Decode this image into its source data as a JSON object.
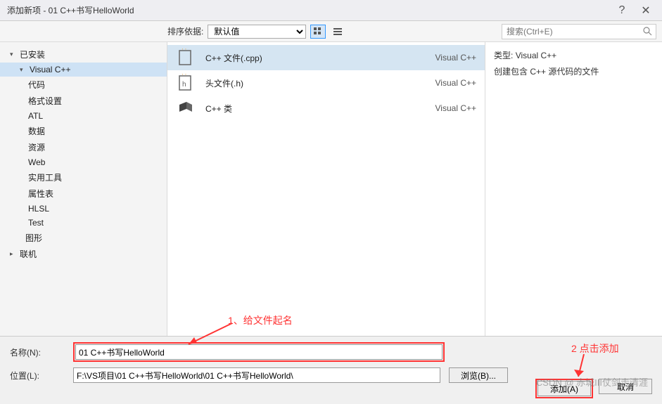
{
  "window": {
    "title": "添加新项 - 01 C++书写HelloWorld",
    "help": "?",
    "close": "✕"
  },
  "toolbar": {
    "sort_label": "排序依据:",
    "sort_value": "默认值",
    "search_placeholder": "搜索(Ctrl+E)"
  },
  "sidebar": {
    "installed": "已安装",
    "vc": "Visual C++",
    "items": [
      "代码",
      "格式设置",
      "ATL",
      "数据",
      "资源",
      "Web",
      "实用工具",
      "属性表",
      "HLSL",
      "Test"
    ],
    "graphics": "图形",
    "online": "联机"
  },
  "templates": [
    {
      "name": "C++ 文件(.cpp)",
      "lang": "Visual C++"
    },
    {
      "name": "头文件(.h)",
      "lang": "Visual C++"
    },
    {
      "name": "C++ 类",
      "lang": "Visual C++"
    }
  ],
  "info": {
    "type_label": "类型:",
    "type_value": "Visual C++",
    "description": "创建包含 C++ 源代码的文件"
  },
  "form": {
    "name_label": "名称(N):",
    "name_value": "01 C++书写HelloWorld",
    "location_label": "位置(L):",
    "location_value": "F:\\VS项目\\01 C++书写HelloWorld\\01 C++书写HelloWorld\\",
    "browse": "浏览(B)...",
    "add": "添加(A)",
    "cancel": "取消"
  },
  "annotations": {
    "step1": "1、给文件起名",
    "step2": "2 点击添加"
  },
  "watermark": "CSDN @ 赤城III仗剑走清涯"
}
